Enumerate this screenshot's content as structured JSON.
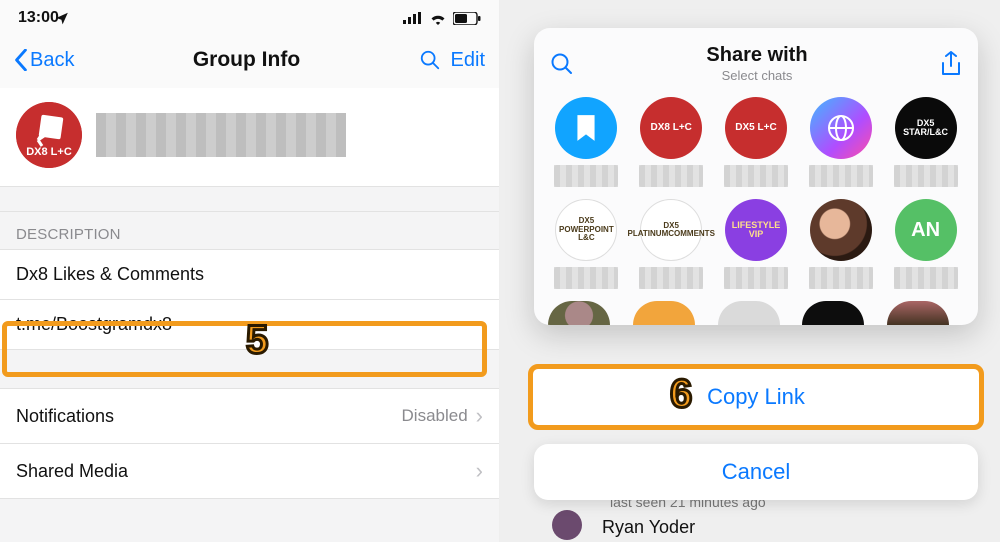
{
  "left": {
    "status": {
      "time": "13:00"
    },
    "nav": {
      "back": "Back",
      "title": "Group Info",
      "edit": "Edit"
    },
    "description_label": "DESCRIPTION",
    "desc_line1": "Dx8 Likes & Comments",
    "desc_link": "t.me/Boostgramdx8",
    "notifications": {
      "label": "Notifications",
      "value": "Disabled"
    },
    "shared_media": {
      "label": "Shared Media"
    },
    "avatar_text": "DX8 L+C",
    "step_badge": "5"
  },
  "right": {
    "sheet": {
      "title": "Share with",
      "subtitle": "Select chats"
    },
    "chats": {
      "r1c1": "",
      "r1c2": "DX8 L+C",
      "r1c3": "DX5 L+C",
      "r1c4": "",
      "r1c5": "DX5 STAR/L&C",
      "r2c1": "DX5 POWERPOINT L&C",
      "r2c2": "DX5 PLATINUMCOMMENTS",
      "r2c3": "LIFESTYLE VIP",
      "r2c4": "",
      "r2c5": "AN"
    },
    "copy_link": "Copy Link",
    "cancel": "Cancel",
    "bg_status": "last seen 21 minutes ago",
    "bg_name": "Ryan Yoder",
    "step_badge": "6"
  }
}
